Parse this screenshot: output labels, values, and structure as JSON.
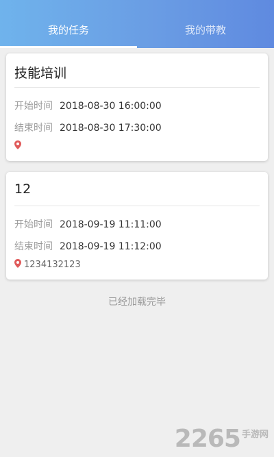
{
  "tabs": [
    {
      "label": "我的任务",
      "active": true
    },
    {
      "label": "我的带教",
      "active": false
    }
  ],
  "colors": {
    "header_gradient_start": "#6fb3ec",
    "header_gradient_end": "#5f8ae0",
    "location_pin": "#e05a5a"
  },
  "tasks": [
    {
      "title": "技能培训",
      "start_label": "开始时间",
      "start_time": "2018-08-30 16:00:00",
      "end_label": "结束时间",
      "end_time": "2018-08-30 17:30:00",
      "location": ""
    },
    {
      "title": "12",
      "start_label": "开始时间",
      "start_time": "2018-09-19 11:11:00",
      "end_label": "结束时间",
      "end_time": "2018-09-19 11:12:00",
      "location": "1234132123"
    }
  ],
  "list_footer": "已经加载完毕",
  "watermark": {
    "main": "2265",
    "sub": "手游网"
  },
  "icons": {
    "location": "location-pin-icon"
  }
}
